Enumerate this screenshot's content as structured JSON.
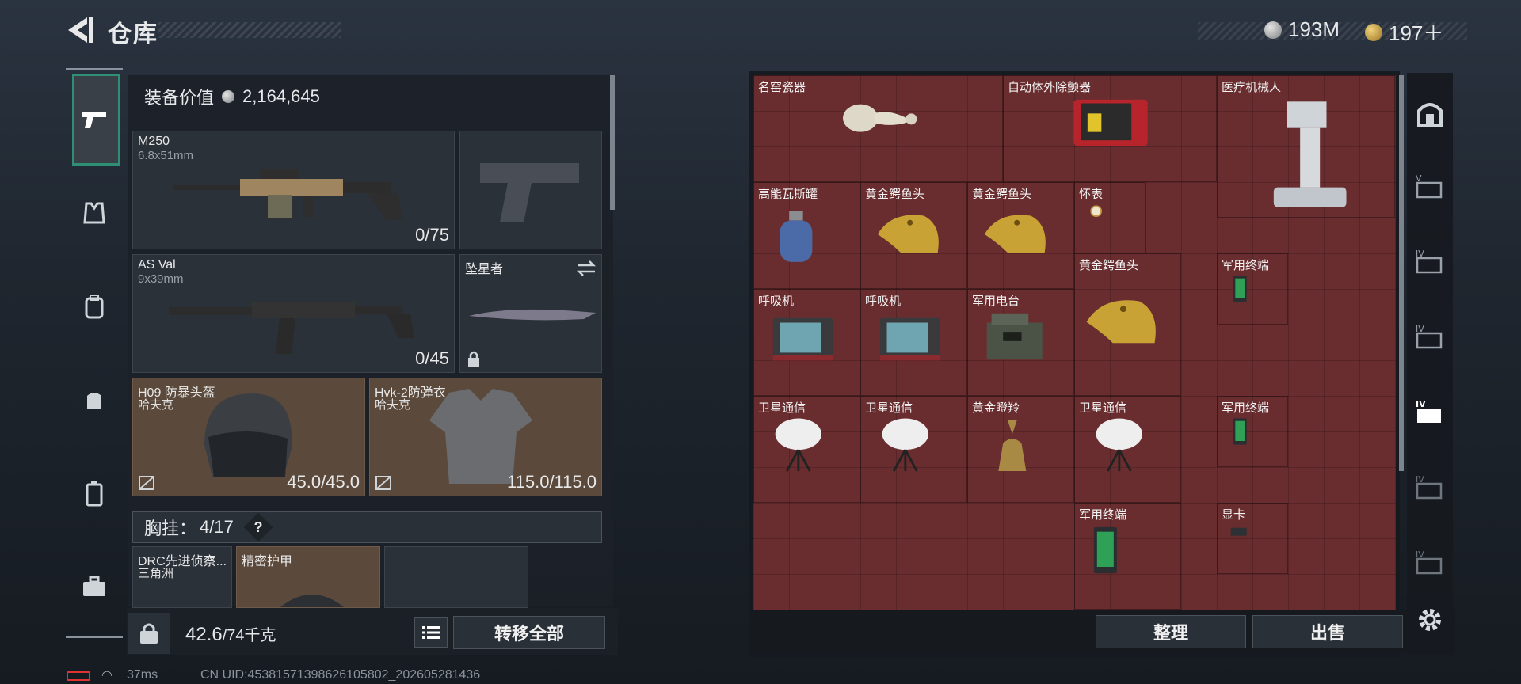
{
  "header": {
    "title": "仓库"
  },
  "currency": {
    "primary": "193M",
    "secondary": "197＋"
  },
  "equipment": {
    "value_label": "装备价值",
    "value": "2,164,645",
    "weapons": [
      {
        "name": "M250",
        "caliber": "6.8x51mm",
        "ammo": "0/75"
      },
      {
        "name": "AS Val",
        "caliber": "9x39mm",
        "ammo": "0/45"
      }
    ],
    "melee": {
      "name": "坠星者"
    },
    "armor": [
      {
        "name": "H09 防暴头盔",
        "brand": "哈夫克",
        "durability": "45.0/45.0"
      },
      {
        "name": "Hvk-2防弹衣",
        "brand": "哈夫克",
        "durability": "115.0/115.0"
      }
    ],
    "rig": {
      "label": "胸挂：",
      "count": "4/17",
      "help": "?"
    },
    "rig_items": [
      {
        "name": "DRC先进侦察...",
        "brand": "三角洲"
      },
      {
        "name": "精密护甲",
        "brand": ""
      }
    ]
  },
  "footer_left": {
    "weight": "42.6",
    "weight_max": "/74千克",
    "transfer_all": "转移全部"
  },
  "status": {
    "ping": "37ms",
    "uid": "CN UID:45381571398626105802_202605281436"
  },
  "stash": {
    "items": [
      {
        "label": "名窑瓷器",
        "icon": "porcelain-vase"
      },
      {
        "label": "自动体外除颤器",
        "icon": "defibrillator"
      },
      {
        "label": "医疗机械人",
        "icon": "medical-robot"
      },
      {
        "label": "高能瓦斯罐",
        "icon": "gas-canister"
      },
      {
        "label": "黄金鳄鱼头",
        "icon": "gold-crocodile-head"
      },
      {
        "label": "黄金鳄鱼头",
        "icon": "gold-crocodile-head"
      },
      {
        "label": "怀表",
        "icon": "pocket-watch"
      },
      {
        "label": "黄金鳄鱼头",
        "icon": "gold-crocodile-head"
      },
      {
        "label": "军用终端",
        "icon": "military-terminal"
      },
      {
        "label": "呼吸机",
        "icon": "ventilator"
      },
      {
        "label": "呼吸机",
        "icon": "ventilator"
      },
      {
        "label": "军用电台",
        "icon": "military-radio"
      },
      {
        "label": "卫星通信",
        "icon": "satellite-dish"
      },
      {
        "label": "军用终端",
        "icon": "military-terminal"
      },
      {
        "label": "卫星通信",
        "icon": "satellite-dish"
      },
      {
        "label": "卫星通信",
        "icon": "satellite-dish"
      },
      {
        "label": "黄金瞪羚",
        "icon": "gold-gazelle"
      },
      {
        "label": "军用终端",
        "icon": "military-terminal"
      },
      {
        "label": "显卡",
        "icon": "graphics-card"
      }
    ],
    "sort_label": "整理",
    "sell_label": "出售"
  },
  "colors": {
    "accent": "#2e8f74",
    "stash_bg": "#6a2d2f",
    "brown_slot": "#5b4a3c",
    "gold": "#c9a235"
  }
}
